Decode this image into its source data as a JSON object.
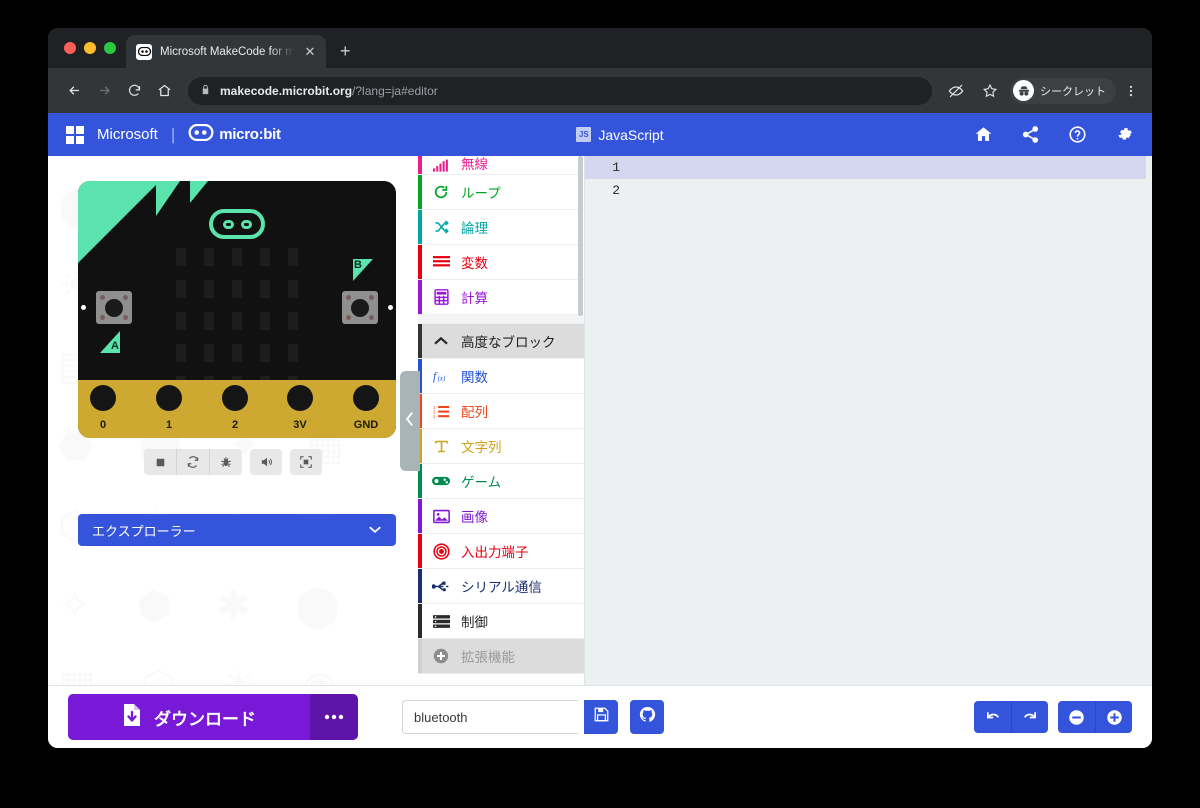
{
  "browser": {
    "tab": {
      "title": "Microsoft MakeCode for micro:",
      "favicon_icon": "microbit-favicon",
      "close_icon": "close-icon"
    },
    "new_tab_icon": "plus-icon",
    "nav": {
      "back_icon": "arrow-left-icon",
      "forward_icon": "arrow-right-icon",
      "reload_icon": "reload-icon",
      "home_icon": "home-icon"
    },
    "omnibox": {
      "lock_icon": "lock-icon",
      "domain": "makecode.microbit.org",
      "path": "/?lang=ja#editor"
    },
    "toolbar_right": {
      "no_tracking_icon": "eye-slash-icon",
      "bookmark_icon": "star-icon",
      "incognito_label": "シークレット",
      "incognito_icon": "incognito-icon",
      "menu_icon": "kebab-menu-icon"
    }
  },
  "header": {
    "microsoft_label": "Microsoft",
    "microsoft_logo_icon": "microsoft-logo-icon",
    "microbit_label": "micro:bit",
    "microbit_logo_icon": "microbit-logo-icon",
    "doc_type_badge": "JS",
    "doc_type_label": "JavaScript",
    "tools": [
      {
        "name": "home-icon",
        "label": "home"
      },
      {
        "name": "share-icon",
        "label": "share"
      },
      {
        "name": "help-icon",
        "label": "help"
      },
      {
        "name": "settings-gear-icon",
        "label": "settings"
      }
    ]
  },
  "simulator": {
    "board": {
      "pins": [
        "0",
        "1",
        "2",
        "3V",
        "GND"
      ],
      "button_a_label": "A",
      "button_b_label": "B"
    },
    "controls": [
      {
        "name": "stop-button",
        "icon": "stop-square-icon"
      },
      {
        "name": "restart-button",
        "icon": "refresh-icon"
      },
      {
        "name": "debug-button",
        "icon": "bug-icon"
      },
      {
        "name": "mute-button",
        "icon": "speaker-icon"
      },
      {
        "name": "fullscreen-button",
        "icon": "expand-icon"
      }
    ],
    "explorer_label": "エクスプローラー",
    "explorer_chevron_icon": "chevron-down-icon"
  },
  "toolbox": {
    "collapse_handle_icon": "chevron-left-icon",
    "items": [
      {
        "label": "無線",
        "color": "#e91e8c",
        "icon": "signal-bars-icon",
        "partial": true
      },
      {
        "label": "ループ",
        "color": "#00a624",
        "icon": "loop-arrow-icon"
      },
      {
        "label": "論理",
        "color": "#00a5a5",
        "icon": "shuffle-icon"
      },
      {
        "label": "変数",
        "color": "#e60012",
        "icon": "lines-icon"
      },
      {
        "label": "計算",
        "color": "#9b19d6",
        "icon": "calculator-icon"
      },
      {
        "label": "高度なブロック",
        "color": "#333333",
        "icon": "chevron-up-icon",
        "state": "advanced"
      },
      {
        "label": "関数",
        "color": "#2253d6",
        "icon": "function-fx-icon"
      },
      {
        "label": "配列",
        "color": "#f1461b",
        "icon": "numbered-list-icon"
      },
      {
        "label": "文字列",
        "color": "#cfa21a",
        "icon": "text-t-icon"
      },
      {
        "label": "ゲーム",
        "color": "#008c4f",
        "icon": "gamepad-icon"
      },
      {
        "label": "画像",
        "color": "#7f19d6",
        "icon": "picture-icon"
      },
      {
        "label": "入出力端子",
        "color": "#e60012",
        "icon": "target-circle-icon"
      },
      {
        "label": "シリアル通信",
        "color": "#1b2f6e",
        "icon": "usb-serial-icon"
      },
      {
        "label": "制御",
        "color": "#2b2b2b",
        "icon": "server-stack-icon"
      },
      {
        "label": "拡張機能",
        "color": "#cfcfcf",
        "icon": "plus-circle-icon",
        "state": "addpkg"
      }
    ]
  },
  "editor": {
    "lines": [
      {
        "number": "1",
        "text": "",
        "active": true
      },
      {
        "number": "2",
        "text": "",
        "active": false
      }
    ]
  },
  "footer": {
    "download_label": "ダウンロード",
    "download_icon": "download-file-icon",
    "download_more_label": "•••",
    "filename_value": "bluetooth",
    "filename_placeholder": "",
    "save_icon": "floppy-save-icon",
    "github_icon": "github-icon",
    "undo_icon": "undo-arrow-icon",
    "redo_icon": "redo-arrow-icon",
    "zoom_out_icon": "minus-circle-icon",
    "zoom_in_icon": "plus-circle-icon"
  },
  "colors": {
    "brand_blue": "#3455db",
    "download_purple": "#7719d6",
    "board_green": "#5be3ae",
    "editor_bg": "#ecf0f1",
    "active_line": "#d4d7ef"
  }
}
